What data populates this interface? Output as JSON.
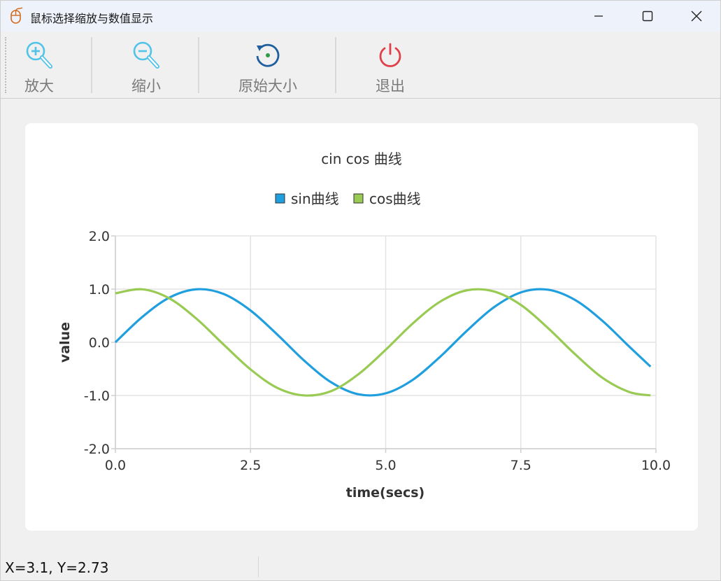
{
  "window": {
    "title": "鼠标选择缩放与数值显示",
    "app_icon": "mouse-icon",
    "controls": [
      "minimize-icon",
      "maximize-icon",
      "close-icon"
    ]
  },
  "toolbar": {
    "items": [
      {
        "label": "放大",
        "icon": "zoom-in-icon",
        "color": "#4fc3e8"
      },
      {
        "label": "缩小",
        "icon": "zoom-out-icon",
        "color": "#4fc3e8"
      },
      {
        "label": "原始大小",
        "icon": "reset-icon",
        "color": "#1f5f9e"
      },
      {
        "label": "退出",
        "icon": "power-icon",
        "color": "#e0404a"
      }
    ]
  },
  "status": {
    "coords": "X=3.1, Y=2.73"
  },
  "chart_data": {
    "type": "line",
    "title": "cin cos 曲线",
    "xlabel": "time(secs)",
    "ylabel": "value",
    "xlim": [
      0,
      10
    ],
    "ylim": [
      -2,
      2
    ],
    "x_ticks": [
      "0.0",
      "2.5",
      "5.0",
      "7.5",
      "10.0"
    ],
    "y_ticks": [
      "2.0",
      "1.0",
      "0.0",
      "-1.0",
      "-2.0"
    ],
    "grid": true,
    "legend_position": "top",
    "x": [
      0,
      0.5,
      1,
      1.5,
      2,
      2.5,
      3,
      3.5,
      4,
      4.5,
      5,
      5.5,
      6,
      6.5,
      7,
      7.5,
      8,
      8.5,
      9,
      9.5,
      9.9
    ],
    "series": [
      {
        "name": "sin曲线",
        "color": "#209fdf",
        "values": [
          0.0,
          0.479,
          0.841,
          0.997,
          0.909,
          0.598,
          0.141,
          -0.351,
          -0.757,
          -0.978,
          -0.959,
          -0.706,
          -0.279,
          0.215,
          0.657,
          0.938,
          0.989,
          0.798,
          0.412,
          -0.075,
          -0.457
        ]
      },
      {
        "name": "cos曲线",
        "color": "#99ca53",
        "values": [
          0.921,
          0.996,
          0.825,
          0.443,
          -0.04,
          -0.509,
          -0.859,
          -0.999,
          -0.914,
          -0.597,
          -0.141,
          0.353,
          0.759,
          0.977,
          0.957,
          0.704,
          0.27,
          -0.22,
          -0.66,
          -0.932,
          -0.998
        ]
      }
    ]
  }
}
